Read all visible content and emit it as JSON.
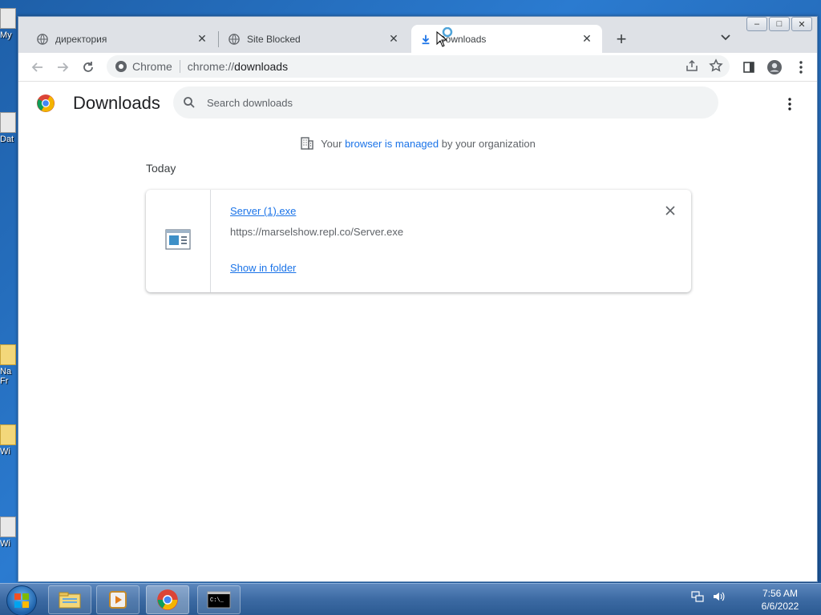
{
  "desktop": {
    "icons": [
      {
        "label": "My"
      },
      {
        "label": "Dat"
      },
      {
        "label": "Na Fr"
      },
      {
        "label": "Wi"
      },
      {
        "label": "Wi"
      }
    ]
  },
  "browser": {
    "tabs": [
      {
        "title": "директория",
        "icon": "globe-icon",
        "active": false
      },
      {
        "title": "Site Blocked",
        "icon": "globe-icon",
        "active": false
      },
      {
        "title": "Downloads",
        "icon": "download-icon",
        "active": true
      }
    ],
    "new_tab_label": "+",
    "window_controls": {
      "minimize": "–",
      "maximize": "□",
      "close": "✕"
    },
    "omnibox": {
      "chip_label": "Chrome",
      "url_scheme": "chrome://",
      "url_host": "downloads"
    }
  },
  "downloads_page": {
    "title": "Downloads",
    "search_placeholder": "Search downloads",
    "managed_notice": {
      "prefix": "Your ",
      "link": "browser is managed",
      "suffix": " by your organization"
    },
    "section_date": "Today",
    "items": [
      {
        "file_name": "Server (1).exe",
        "url": "https://marselshow.repl.co/Server.exe",
        "action": "Show in folder"
      }
    ]
  },
  "taskbar": {
    "clock_time": "7:56 AM",
    "clock_date": "6/6/2022",
    "pinned": [
      "explorer-icon",
      "media-player-icon",
      "chrome-icon",
      "cmd-icon"
    ]
  },
  "colors": {
    "accent": "#1a73e8",
    "tabstrip": "#dee1e6",
    "omnibox": "#f1f3f4"
  }
}
